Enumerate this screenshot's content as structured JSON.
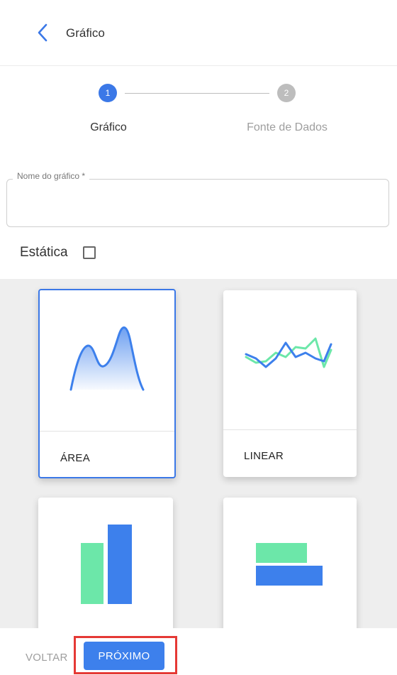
{
  "header": {
    "title": "Gráfico",
    "back_icon": "chevron-left-icon"
  },
  "stepper": {
    "steps": [
      {
        "number": "1",
        "label": "Gráfico",
        "state": "active"
      },
      {
        "number": "2",
        "label": "Fonte de Dados",
        "state": "inactive"
      }
    ]
  },
  "form": {
    "name_field": {
      "label": "Nome do gráfico *",
      "value": ""
    },
    "static_label": "Estática",
    "static_checked": false
  },
  "chart_types": [
    {
      "label": "ÁREA",
      "icon": "area-chart-icon",
      "selected": true
    },
    {
      "label": "LINEAR",
      "icon": "line-chart-icon",
      "selected": false
    },
    {
      "label": "",
      "icon": "bar-chart-icon",
      "selected": false
    },
    {
      "label": "",
      "icon": "horizontal-bar-chart-icon",
      "selected": false
    }
  ],
  "footer": {
    "back_label": "VOLTAR",
    "next_label": "PRÓXIMO"
  },
  "colors": {
    "accent": "#3d80ec",
    "secondary": "#6ce7a9",
    "highlight": "#e53935"
  }
}
